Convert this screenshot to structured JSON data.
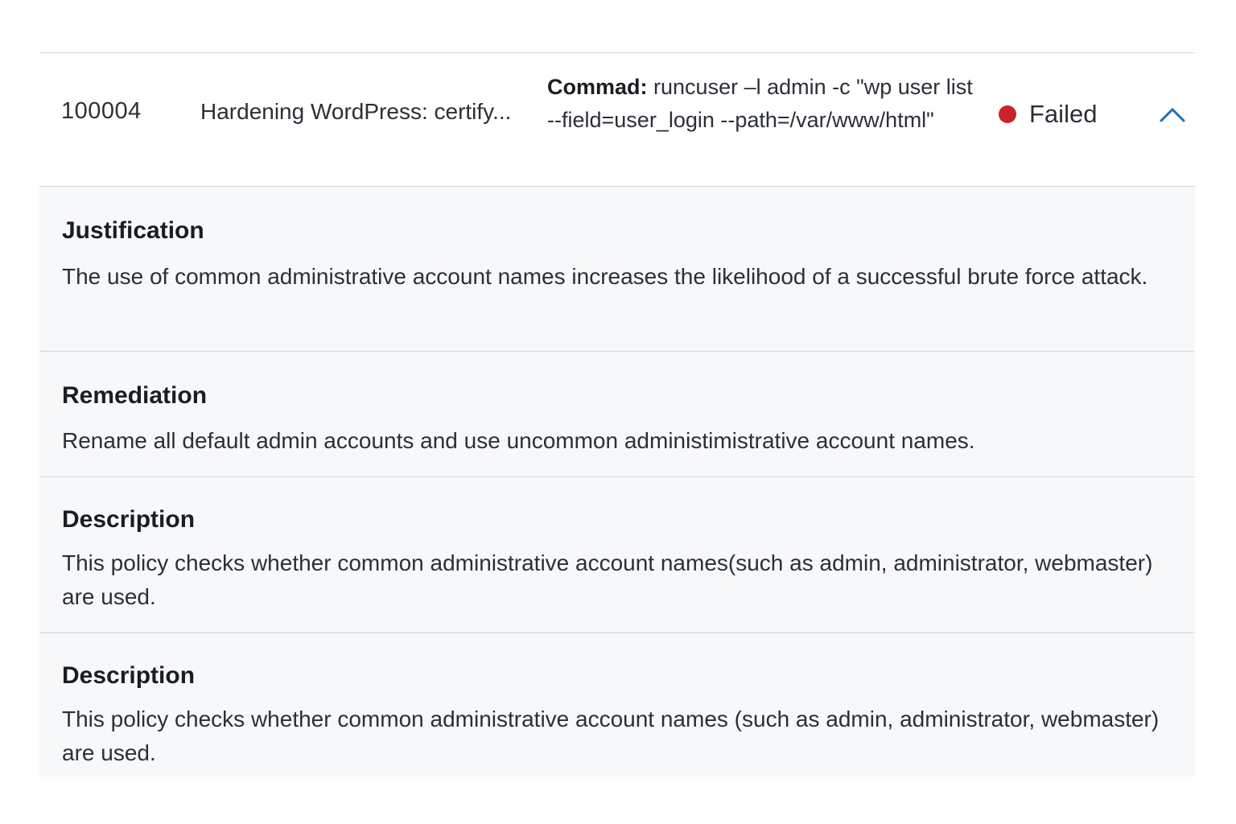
{
  "row": {
    "id": "100004",
    "name": "Hardening WordPress: certify...",
    "command_label": "Commad:",
    "command_value": "runcuser –l admin -c \"wp user list --field=user_login --path=/var/www/html\"",
    "status": "Failed",
    "status_color": "#c8232c",
    "toggle_icon": "chevron-up-icon"
  },
  "details": {
    "justification": {
      "heading": "Justification",
      "text": "The use of common administrative account names increases the likelihood of a successful brute force attack."
    },
    "remediation": {
      "heading": "Remediation",
      "text": "Rename all default admin accounts and use uncommon administimistrative account names."
    },
    "description_1": {
      "heading": "Description",
      "text": "This policy checks whether common administrative account names(such as admin, administrator, webmaster) are used."
    },
    "description_2": {
      "heading": "Description",
      "text": "This policy checks whether common administrative account names (such as admin, administrator, webmaster) are used."
    }
  }
}
